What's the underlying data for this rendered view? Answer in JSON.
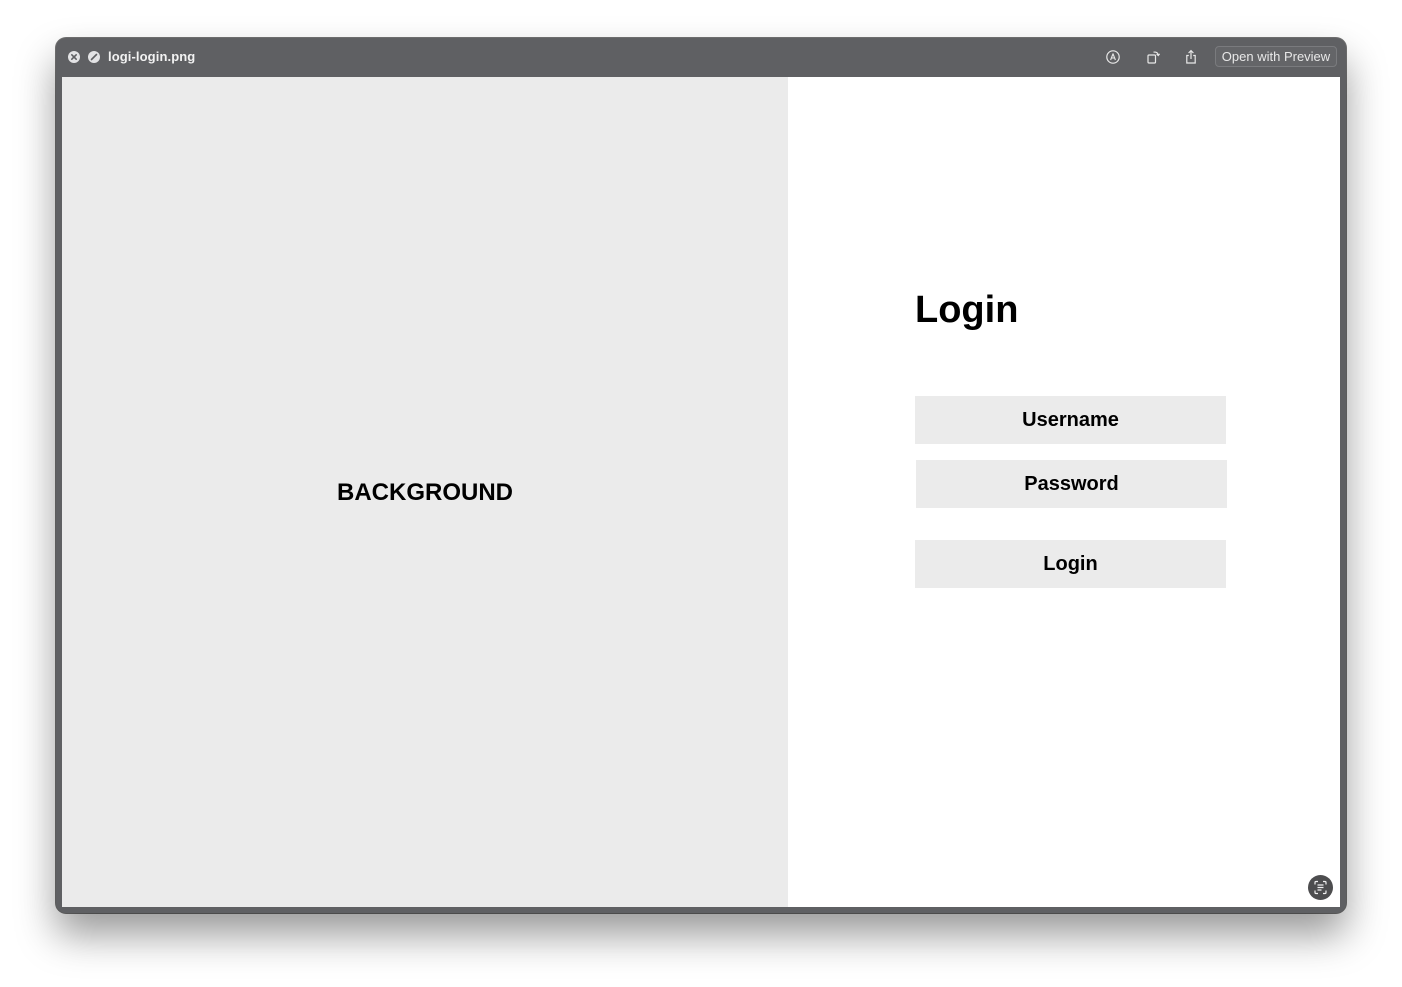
{
  "window": {
    "title": "logi-login.png",
    "open_with_label": "Open with Preview",
    "icons": {
      "close": "close-icon",
      "fullscreen": "fullscreen-icon",
      "markup": "markup-icon",
      "rotate": "rotate-icon",
      "share": "share-icon",
      "live_text": "live-text-icon"
    }
  },
  "image": {
    "background_label": "BACKGROUND",
    "login_title": "Login",
    "username_label": "Username",
    "password_label": "Password",
    "login_button_label": "Login"
  },
  "colors": {
    "titlebar": "#5f6063",
    "panel_gray": "#ebebeb",
    "content_white": "#ffffff",
    "text": "#000000"
  }
}
